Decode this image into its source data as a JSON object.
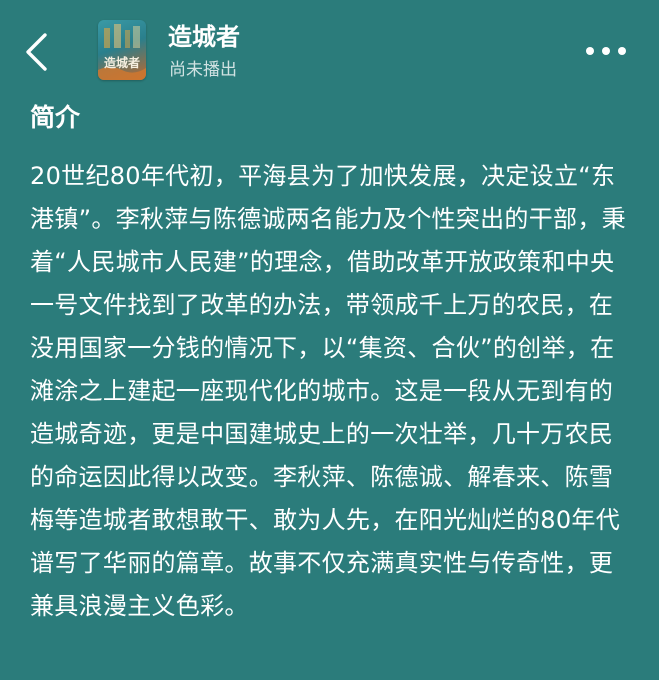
{
  "header": {
    "back_icon": "chevron-left-icon",
    "cover_text": "造城者",
    "title": "造城者",
    "subtitle": "尚未播出",
    "more_icon": "more-horizontal-icon"
  },
  "intro": {
    "heading": "简介",
    "text": "20世纪80年代初，平海县为了加快发展，决定设立“东港镇”。李秋萍与陈德诚两名能力及个性突出的干部，秉着“人民城市人民建”的理念，借助改革开放政策和中央一号文件找到了改革的办法，带领成千上万的农民，在没用国家一分钱的情况下，以“集资、合伙”的创举，在滩涂之上建起一座现代化的城市。这是一段从无到有的造城奇迹，更是中国建城史上的一次壮举，几十万农民的命运因此得以改变。李秋萍、陈德诚、解春来、陈雪梅等造城者敢想敢干、敢为人先，在阳光灿烂的80年代谱写了华丽的篇章。故事不仅充满真实性与传奇性，更兼具浪漫主义色彩。"
  },
  "colors": {
    "background": "#2b7c7b",
    "text": "#ffffff"
  }
}
